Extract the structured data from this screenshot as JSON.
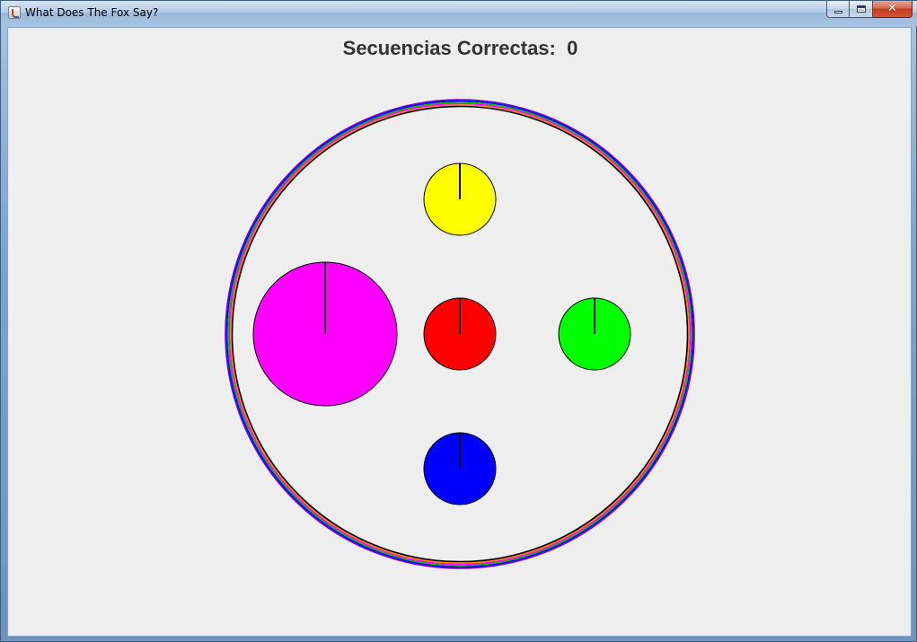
{
  "window": {
    "title": "What Does The Fox Say?",
    "buttons": {
      "minimize": "minimize-icon",
      "maximize": "maximize-icon",
      "close": "✕"
    }
  },
  "game": {
    "score_label": "Secuencias Correctas:",
    "score_value": "0",
    "board_rings": [
      "#7b00d6",
      "#0000ff",
      "#00c000",
      "#ff00ff",
      "#ff8800",
      "#000000"
    ],
    "buttons": [
      {
        "name": "yellow-button",
        "color": "#ffff00",
        "active": false
      },
      {
        "name": "magenta-button",
        "color": "#ff00ff",
        "active": true
      },
      {
        "name": "red-button",
        "color": "#ff0000",
        "active": false
      },
      {
        "name": "green-button",
        "color": "#00ff00",
        "active": false
      },
      {
        "name": "blue-button",
        "color": "#0000ff",
        "active": false
      }
    ]
  }
}
